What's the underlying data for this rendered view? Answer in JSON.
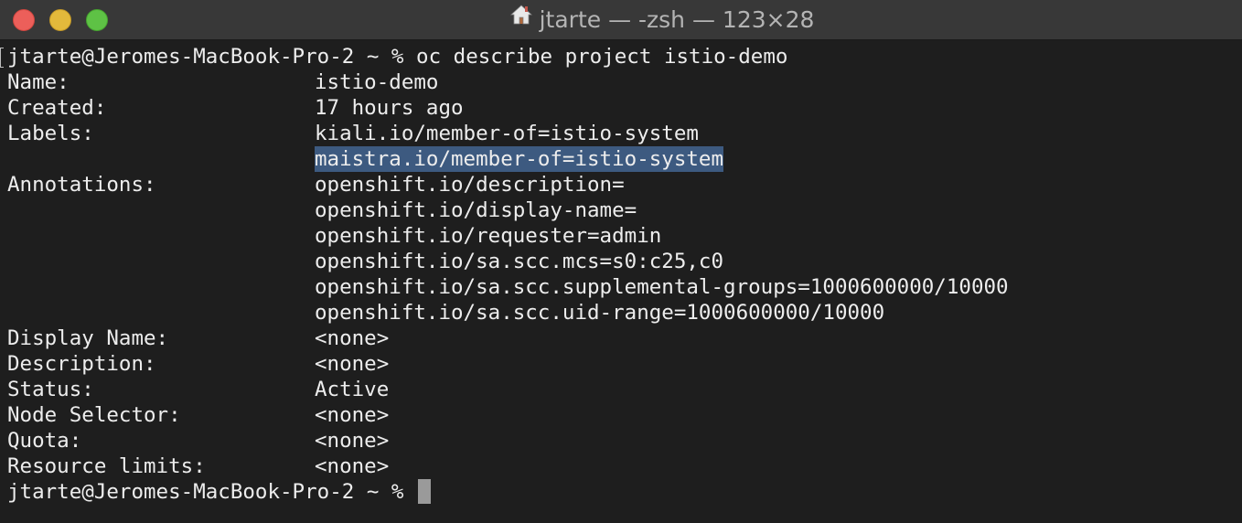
{
  "window": {
    "title": "jtarte — -zsh — 123×28",
    "title_icon": "home-icon"
  },
  "terminal": {
    "command_line": "jtarte@Jeromes-MacBook-Pro-2 ~ % oc describe project istio-demo",
    "fields": [
      {
        "label": "Name:",
        "value": "istio-demo"
      },
      {
        "label": "Created:",
        "value": "17 hours ago"
      },
      {
        "label": "Labels:",
        "value": "kiali.io/member-of=istio-system"
      },
      {
        "label": "",
        "value": "maistra.io/member-of=istio-system",
        "selected": true
      },
      {
        "label": "Annotations:",
        "value": "openshift.io/description="
      },
      {
        "label": "",
        "value": "openshift.io/display-name="
      },
      {
        "label": "",
        "value": "openshift.io/requester=admin"
      },
      {
        "label": "",
        "value": "openshift.io/sa.scc.mcs=s0:c25,c0"
      },
      {
        "label": "",
        "value": "openshift.io/sa.scc.supplemental-groups=1000600000/10000"
      },
      {
        "label": "",
        "value": "openshift.io/sa.scc.uid-range=1000600000/10000"
      },
      {
        "label": "Display Name:",
        "value": "<none>"
      },
      {
        "label": "Description:",
        "value": "<none>"
      },
      {
        "label": "Status:",
        "value": "Active"
      },
      {
        "label": "Node Selector:",
        "value": "<none>"
      },
      {
        "label": "Quota:",
        "value": "<none>"
      },
      {
        "label": "Resource limits:",
        "value": "<none>"
      }
    ],
    "prompt": "jtarte@Jeromes-MacBook-Pro-2 ~ % "
  },
  "colors": {
    "background": "#1e1e1e",
    "titlebar": "#383838",
    "text": "#ededed",
    "selection": "#3d5a80",
    "cursor": "#9a9a9a"
  }
}
